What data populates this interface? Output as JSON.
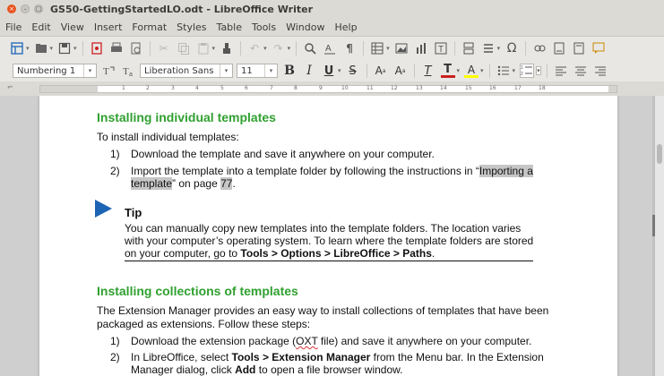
{
  "window": {
    "title": "GS50-GettingStartedLO.odt - LibreOffice Writer",
    "close_glyph": "×",
    "minimize_glyph": "–",
    "maximize_glyph": "□"
  },
  "menu": [
    "File",
    "Edit",
    "View",
    "Insert",
    "Format",
    "Styles",
    "Table",
    "Tools",
    "Window",
    "Help"
  ],
  "toolbar": {
    "paragraph_style": "Numbering 1",
    "font_name": "Liberation Sans",
    "font_size": "11",
    "bold_glyph": "B",
    "italic_glyph": "I",
    "underline_glyph": "U",
    "strike_glyph": "S",
    "superscript_glyph": "A",
    "subscript_glyph": "A",
    "clear_glyph": "T",
    "font_color_glyph": "T",
    "highlight_glyph": "A",
    "omega_glyph": "Ω"
  },
  "ruler": {
    "ticks": [
      "1",
      "2",
      "3",
      "4",
      "5",
      "6",
      "7",
      "8",
      "9",
      "10",
      "11",
      "12",
      "13",
      "14",
      "15",
      "16",
      "17",
      "18"
    ]
  },
  "document": {
    "heading1": "Installing individual templates",
    "intro1": "To install individual templates:",
    "list1": [
      {
        "num": "1)",
        "text": "Download the template and save it anywhere on your computer."
      },
      {
        "num": "2)",
        "pre": "Import the template into a template folder by following the instructions in “",
        "link1": "Importing a",
        "link2": "template",
        "post": "” on page ",
        "page": "77",
        "end": "."
      }
    ],
    "tip": {
      "title": "Tip",
      "line1": "You can manually copy new templates into the template folders. The location varies",
      "line2": "with your computer’s operating system. To learn where the template folders are stored",
      "line3_pre": "on your computer, go to ",
      "line3_bold": "Tools > Options > LibreOffice > Paths",
      "line3_post": "."
    },
    "heading2": "Installing collections of templates",
    "intro2_line1": "The Extension Manager provides an easy way to install collections of templates that have been",
    "intro2_line2": "packaged as extensions. Follow these steps:",
    "list2": [
      {
        "num": "1)",
        "pre": "Download the extension package (",
        "spell": "OXT",
        "post": " file) and save it anywhere on your computer."
      },
      {
        "num": "2)",
        "pre": "In LibreOffice, select ",
        "bold": "Tools > Extension Manager",
        "post": " from the Menu bar. In the Extension",
        "line2_pre": "Manager dialog, click ",
        "line2_bold": "Add",
        "line2_post": " to open a file browser window."
      }
    ]
  }
}
